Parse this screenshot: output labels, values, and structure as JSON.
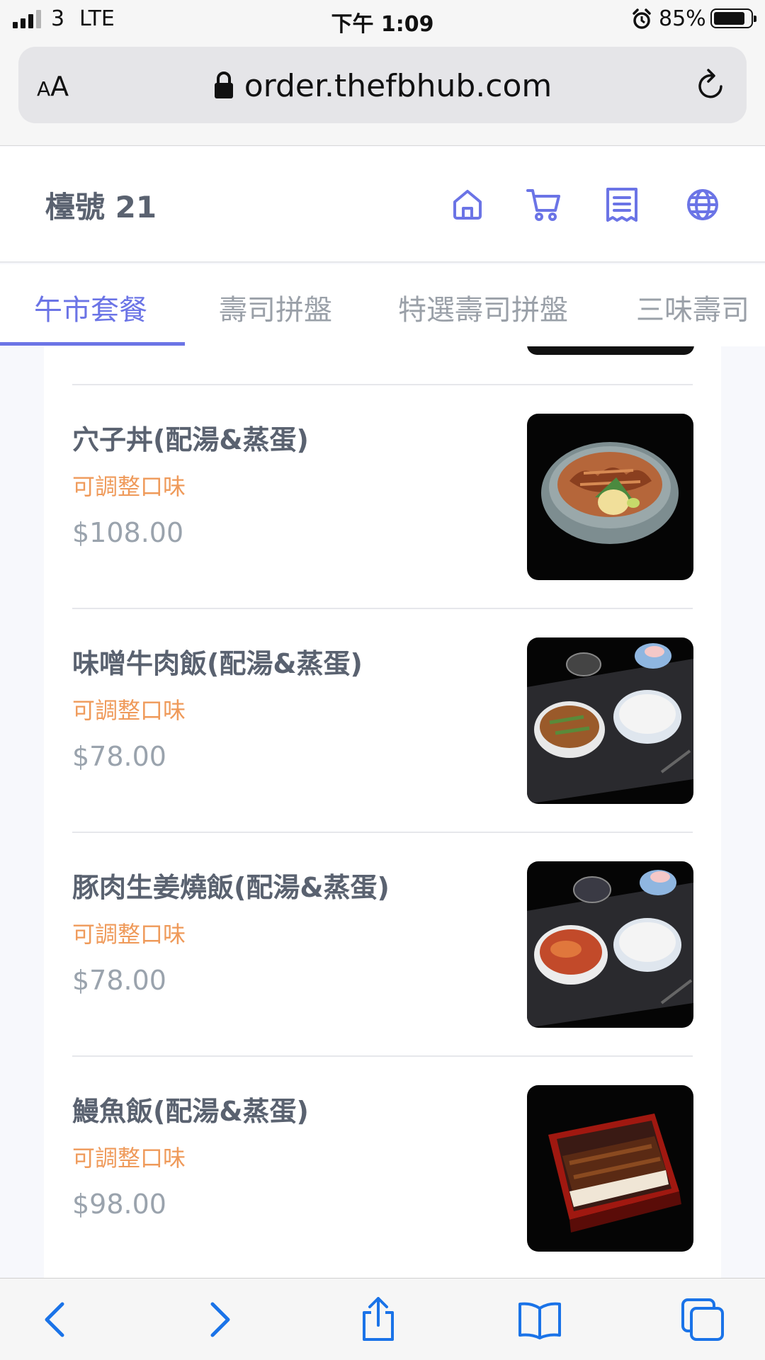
{
  "status_bar": {
    "carrier": "3",
    "network": "LTE",
    "time": "下午 1:09",
    "battery_percent": "85%",
    "battery_level": 0.85,
    "signal_bars": 3
  },
  "browser": {
    "text_size_label_small": "A",
    "text_size_label_large": "A",
    "url": "order.thefbhub.com"
  },
  "header": {
    "table_label": "檯號 21",
    "icons": [
      "home-icon",
      "cart-icon",
      "receipt-icon",
      "globe-icon"
    ]
  },
  "tabs": [
    {
      "label": "午市套餐",
      "active": true
    },
    {
      "label": "壽司拼盤",
      "active": false
    },
    {
      "label": "特選壽司拼盤",
      "active": false
    },
    {
      "label": "三味壽司",
      "active": false
    }
  ],
  "menu_items": [
    {
      "name": "穴子丼(配湯&蒸蛋)",
      "note": "可調整口味",
      "price": "$108.00",
      "image": "anago-don-bowl"
    },
    {
      "name": "味噌牛肉飯(配湯&蒸蛋)",
      "note": "可調整口味",
      "price": "$78.00",
      "image": "miso-beef-rice-set"
    },
    {
      "name": "豚肉生姜燒飯(配湯&蒸蛋)",
      "note": "可調整口味",
      "price": "$78.00",
      "image": "pork-ginger-rice-set"
    },
    {
      "name": "鰻魚飯(配湯&蒸蛋)",
      "note": "可調整口味",
      "price": "$98.00",
      "image": "unagi-rice-box"
    }
  ],
  "colors": {
    "accent": "#6b74e6",
    "note": "#ef9a5a",
    "title": "#5a6270",
    "price": "#9aa3ad"
  },
  "toolbar": [
    "back-icon",
    "forward-icon",
    "share-icon",
    "bookmarks-icon",
    "tabs-icon"
  ]
}
